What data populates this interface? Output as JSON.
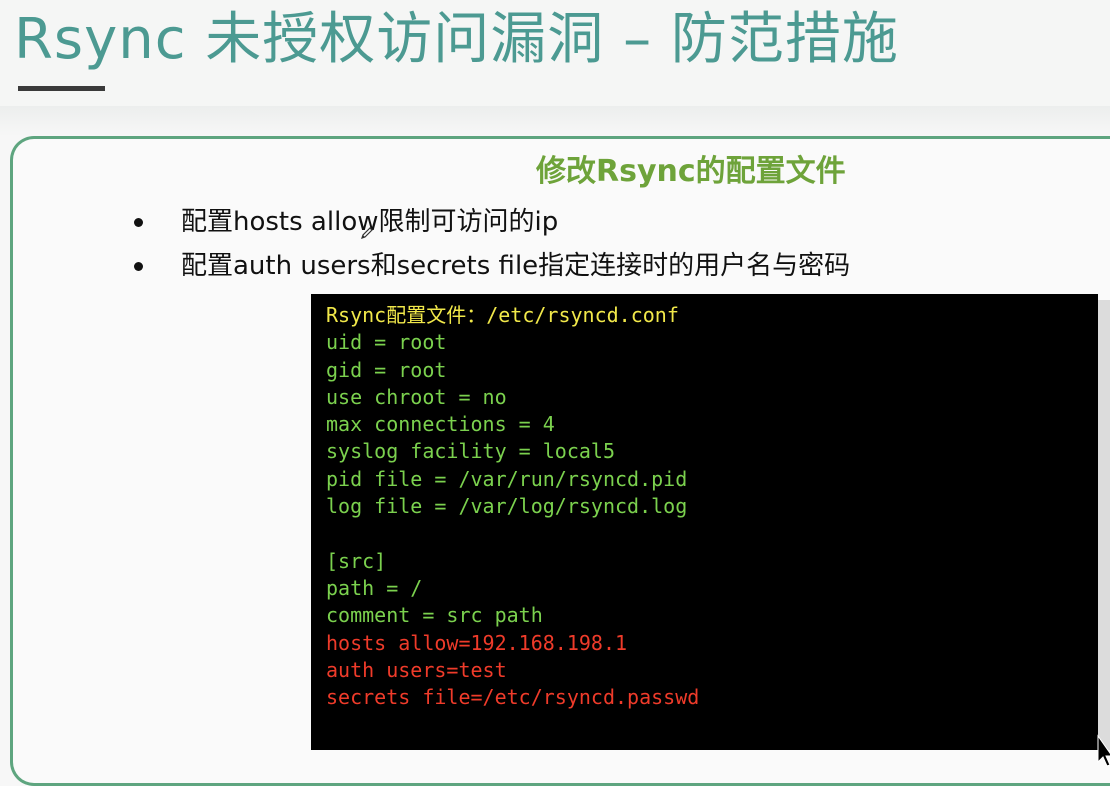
{
  "slide": {
    "title": "Rsync 未授权访问漏洞 – 防范措施",
    "subtitle": "修改Rsync的配置文件",
    "bullets": [
      "配置hosts allow限制可访问的ip",
      "配置auth users和secrets file指定连接时的用户名与密码"
    ]
  },
  "terminal": {
    "lines": [
      {
        "text": "Rsync配置文件：/etc/rsyncd.conf",
        "color": "yellow"
      },
      {
        "text": "uid = root",
        "color": "green"
      },
      {
        "text": "gid = root",
        "color": "green"
      },
      {
        "text": "use chroot = no",
        "color": "green"
      },
      {
        "text": "max connections = 4",
        "color": "green"
      },
      {
        "text": "syslog facility = local5",
        "color": "green"
      },
      {
        "text": "pid file = /var/run/rsyncd.pid",
        "color": "green"
      },
      {
        "text": "log file = /var/log/rsyncd.log",
        "color": "green"
      },
      {
        "text": "",
        "color": "green"
      },
      {
        "text": "[src]",
        "color": "green"
      },
      {
        "text": "path = /",
        "color": "green"
      },
      {
        "text": "comment = src path",
        "color": "green"
      },
      {
        "text": "hosts allow=192.168.198.1",
        "color": "red"
      },
      {
        "text": "auth users=test",
        "color": "red"
      },
      {
        "text": "secrets file=/etc/rsyncd.passwd",
        "color": "red"
      }
    ]
  },
  "colors": {
    "title": "#4c9a92",
    "subtitle": "#6ea33a",
    "panel_border": "#5ea57f",
    "terminal_bg": "#000000",
    "code_yellow": "#f1e84a",
    "code_green": "#7bd14e",
    "code_red": "#ef3b2a"
  },
  "icons": {
    "cursor": "pencil-icon",
    "corner": "mouse-cursor-icon"
  }
}
